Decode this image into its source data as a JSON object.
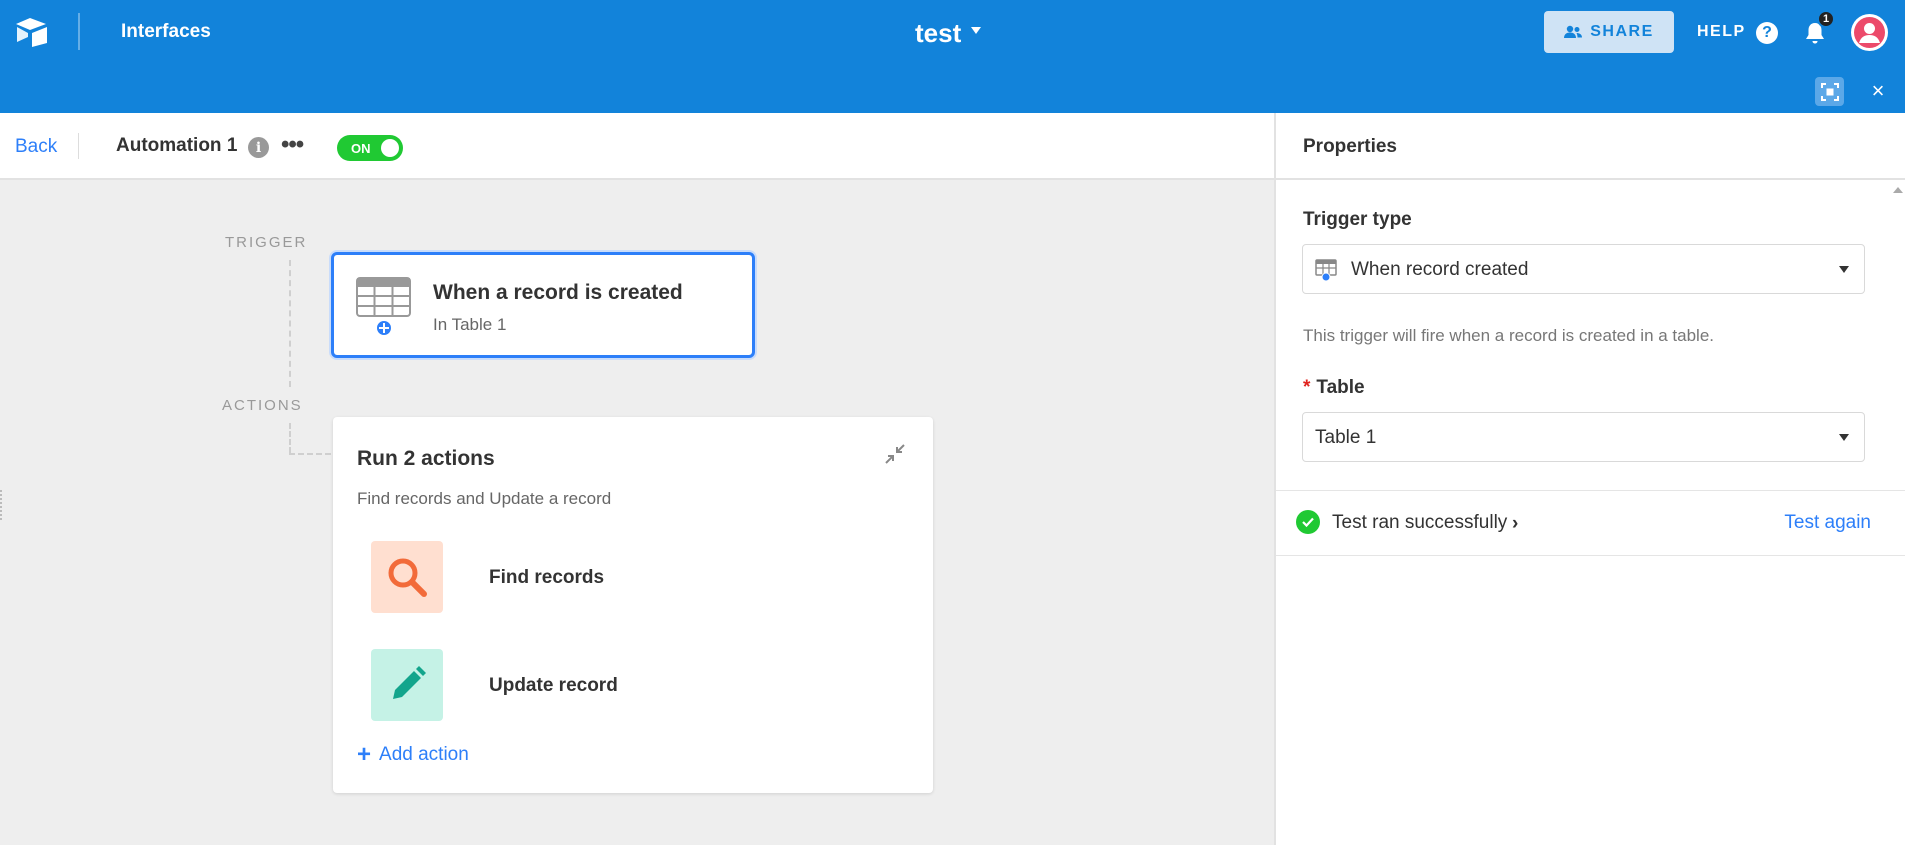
{
  "topbar": {
    "brand": "Interfaces",
    "base_name": "test",
    "share_label": "SHARE",
    "help_label": "HELP",
    "help_icon": "?",
    "notification_count": "1",
    "close_icon": "×"
  },
  "automation": {
    "back_label": "Back",
    "name": "Automation 1",
    "info_icon": "i",
    "more_icon": "•••",
    "toggle_label": "ON"
  },
  "canvas": {
    "trigger_label": "TRIGGER",
    "actions_label": "ACTIONS",
    "trigger_card": {
      "title": "When a record is created",
      "subtitle": "In Table 1"
    },
    "actions_card": {
      "title": "Run 2 actions",
      "subtitle": "Find records and Update a record",
      "actions": [
        {
          "label": "Find records",
          "icon": "search-icon",
          "color": "#ffdfd0"
        },
        {
          "label": "Update record",
          "icon": "pencil-icon",
          "color": "#c5f2e6"
        }
      ],
      "add_label": "Add action",
      "add_icon": "+"
    }
  },
  "properties": {
    "title": "Properties",
    "trigger_type_label": "Trigger type",
    "trigger_type_value": "When record created",
    "description": "This trigger will fire when a record is created in a table.",
    "table_required_mark": "*",
    "table_label": "Table",
    "table_value": "Table 1",
    "test_status": "Test ran successfully",
    "test_chevron": "›",
    "test_again_label": "Test again"
  },
  "colors": {
    "topbar": "#1283da",
    "accent": "#2d7ff9",
    "success": "#20c933"
  }
}
